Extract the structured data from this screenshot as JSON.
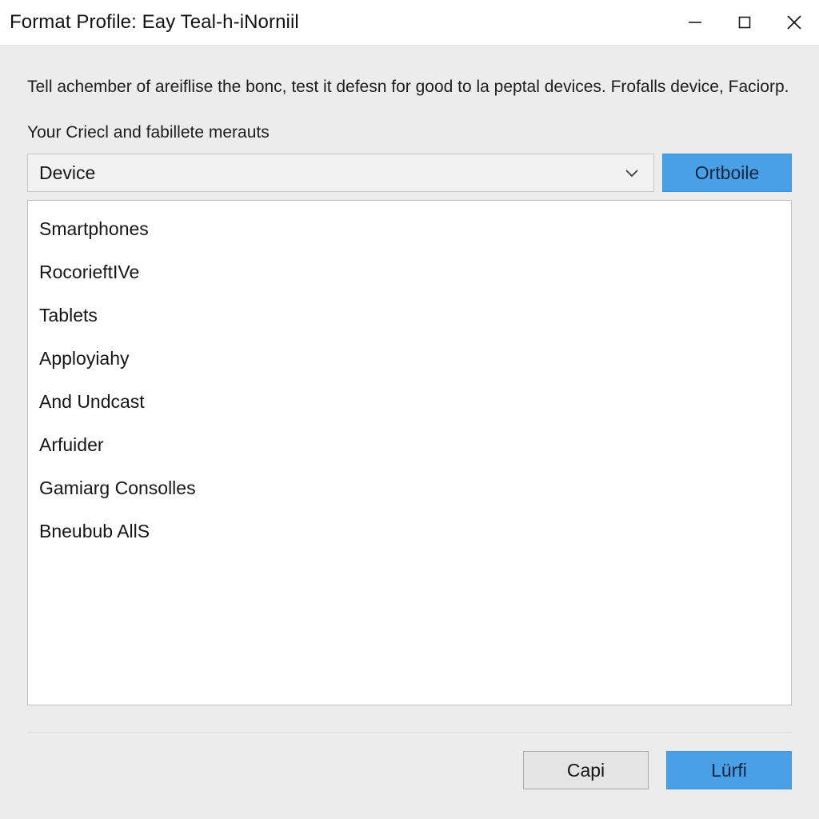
{
  "window": {
    "title": "Format Profile: Eay Teal-h-iNorniil",
    "controls": [
      {
        "name": "minimize",
        "glyph": "minimize-icon"
      },
      {
        "name": "maximize",
        "glyph": "maximize-icon"
      },
      {
        "name": "close",
        "glyph": "close-icon"
      }
    ]
  },
  "main": {
    "description": "Tell achember of areiflise the bonc, test it defesn for good to la peptal devices. Frofalls device, Faciorp.",
    "field_label": "Your Criecl and fabillete merauts",
    "combobox": {
      "value": "Device",
      "chevron": "chevron-down-icon"
    },
    "action_button": "Ortboile",
    "list_items": [
      "Smartphones",
      "RocorieftIVe",
      "Tablets",
      "Apployiahy",
      "And Undcast",
      "Arfuider",
      "Gamiarg Consolles",
      "Bneubub AllS"
    ]
  },
  "footer": {
    "cancel_label": "Capi",
    "confirm_label": "Lürfi"
  },
  "colors": {
    "accent": "#4aa0e6",
    "window_background": "#ececec",
    "titlebar_background": "#ffffff",
    "panel_background": "#ffffff",
    "text": "#161616"
  }
}
